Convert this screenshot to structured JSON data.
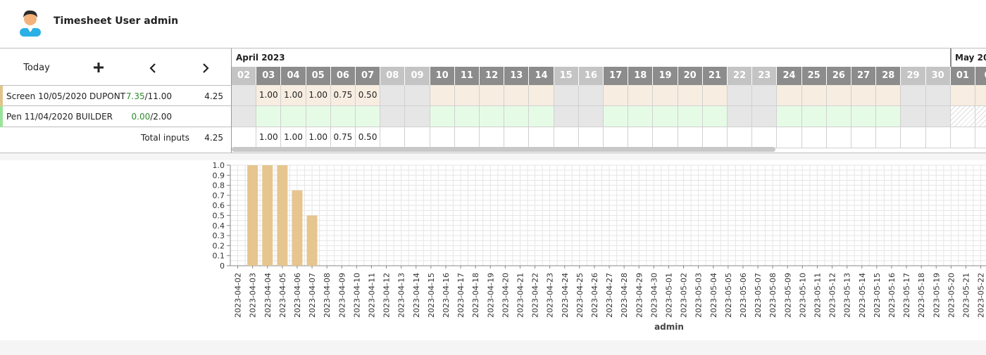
{
  "header": {
    "title": "Timesheet User admin"
  },
  "toolbar": {
    "today_label": "Today",
    "add_icon": "plus-icon",
    "prev_icon": "chevron-left-icon",
    "next_icon": "chevron-right-icon"
  },
  "tasks": [
    {
      "name": "Screen 10/05/2020 DUPONT",
      "done": "7.35",
      "planned": "/11.00",
      "total": "4.25",
      "color": "#e2c48a",
      "fill": "#f7ede0"
    },
    {
      "name": "Pen 11/04/2020 BUILDER",
      "done": "0.00",
      "planned": "/2.00",
      "total": "",
      "color": "#9be39b",
      "fill": "#e6fbe6"
    }
  ],
  "totals": {
    "label": "Total inputs",
    "value": "4.25"
  },
  "calendar": {
    "months": [
      {
        "label": "April 2023"
      },
      {
        "label": "May 20"
      }
    ],
    "days": [
      {
        "d": "02",
        "w": true
      },
      {
        "d": "03"
      },
      {
        "d": "04"
      },
      {
        "d": "05"
      },
      {
        "d": "06"
      },
      {
        "d": "07"
      },
      {
        "d": "08",
        "w": true
      },
      {
        "d": "09",
        "w": true
      },
      {
        "d": "10"
      },
      {
        "d": "11"
      },
      {
        "d": "12"
      },
      {
        "d": "13"
      },
      {
        "d": "14"
      },
      {
        "d": "15",
        "w": true
      },
      {
        "d": "16",
        "w": true
      },
      {
        "d": "17"
      },
      {
        "d": "18"
      },
      {
        "d": "19"
      },
      {
        "d": "20"
      },
      {
        "d": "21"
      },
      {
        "d": "22",
        "w": true
      },
      {
        "d": "23",
        "w": true
      },
      {
        "d": "24"
      },
      {
        "d": "25"
      },
      {
        "d": "26"
      },
      {
        "d": "27"
      },
      {
        "d": "28"
      },
      {
        "d": "29",
        "w": true
      },
      {
        "d": "30",
        "w": true
      },
      {
        "d": "01"
      },
      {
        "d": "0"
      }
    ],
    "row1_values": [
      "",
      "1.00",
      "1.00",
      "1.00",
      "0.75",
      "0.50"
    ],
    "total_values": [
      "",
      "1.00",
      "1.00",
      "1.00",
      "0.75",
      "0.50"
    ],
    "colors": {
      "header_weekday": "#8c8c8c",
      "header_weekend": "#c4c4c4",
      "weekend_cell": "#e6e6e6"
    }
  },
  "chart_data": {
    "type": "bar",
    "xlabel": "admin",
    "ylim": [
      0,
      1.0
    ],
    "yticks": [
      "0",
      "0.1",
      "0.2",
      "0.3",
      "0.4",
      "0.5",
      "0.6",
      "0.7",
      "0.8",
      "0.9",
      "1.0"
    ],
    "categories": [
      "2023-04-02",
      "2023-04-03",
      "2023-04-04",
      "2023-04-05",
      "2023-04-06",
      "2023-04-07",
      "2023-04-08",
      "2023-04-09",
      "2023-04-10",
      "2023-04-11",
      "2023-04-12",
      "2023-04-13",
      "2023-04-14",
      "2023-04-15",
      "2023-04-16",
      "2023-04-17",
      "2023-04-18",
      "2023-04-19",
      "2023-04-20",
      "2023-04-21",
      "2023-04-22",
      "2023-04-23",
      "2023-04-24",
      "2023-04-25",
      "2023-04-26",
      "2023-04-27",
      "2023-04-28",
      "2023-04-29",
      "2023-04-30",
      "2023-05-01",
      "2023-05-02",
      "2023-05-03",
      "2023-05-04",
      "2023-05-05",
      "2023-05-06",
      "2023-05-07",
      "2023-05-08",
      "2023-05-09",
      "2023-05-10",
      "2023-05-11",
      "2023-05-12",
      "2023-05-13",
      "2023-05-14",
      "2023-05-15",
      "2023-05-16",
      "2023-05-17",
      "2023-05-18",
      "2023-05-19",
      "2023-05-20",
      "2023-05-21",
      "2023-05-22"
    ],
    "values": [
      0,
      1.0,
      1.0,
      1.0,
      0.75,
      0.5,
      0,
      0,
      0,
      0,
      0,
      0,
      0,
      0,
      0,
      0,
      0,
      0,
      0,
      0,
      0,
      0,
      0,
      0,
      0,
      0,
      0,
      0,
      0,
      0,
      0,
      0,
      0,
      0,
      0,
      0,
      0,
      0,
      0,
      0,
      0,
      0,
      0,
      0,
      0,
      0,
      0,
      0,
      0,
      0,
      0
    ],
    "bar_color": "#e6c58f",
    "grid": true
  }
}
